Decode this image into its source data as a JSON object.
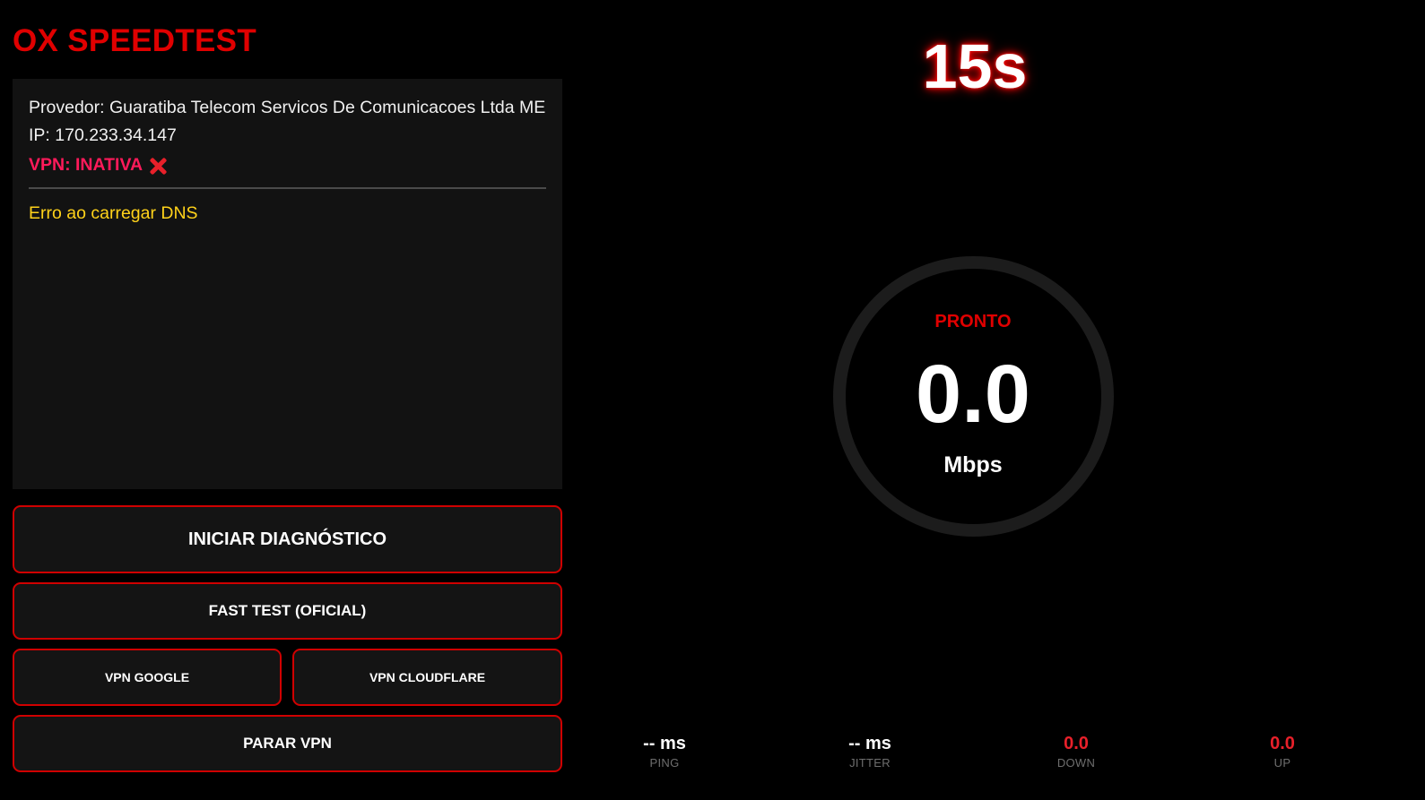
{
  "app": {
    "title": "OX SPEEDTEST"
  },
  "info": {
    "provider": "Provedor: Guaratiba Telecom Servicos De Comunicacoes Ltda ME",
    "ip": "IP: 170.233.34.147",
    "vpn_status": "VPN: INATIVA",
    "vpn_status_icon": "cross-mark-icon",
    "dns_message": "Erro ao carregar DNS"
  },
  "buttons": {
    "start_diagnostic": "INICIAR DIAGNÓSTICO",
    "fast_test": "FAST TEST (OFICIAL)",
    "vpn_google": "VPN GOOGLE",
    "vpn_cloudflare": "VPN CLOUDFLARE",
    "stop_vpn": "PARAR VPN"
  },
  "timer": "15s",
  "gauge": {
    "status": "PRONTO",
    "value": "0.0",
    "unit": "Mbps"
  },
  "stats": {
    "ping": {
      "value": "-- ms",
      "label": "PING"
    },
    "jitter": {
      "value": "-- ms",
      "label": "JITTER"
    },
    "down": {
      "value": "0.0",
      "label": "DOWN"
    },
    "up": {
      "value": "0.0",
      "label": "UP"
    }
  },
  "colors": {
    "accent": "#e00000",
    "vpn_inactive": "#ff1a5a",
    "dns_warning": "#ffd21a",
    "panel_bg": "#121212",
    "background": "#000000"
  }
}
